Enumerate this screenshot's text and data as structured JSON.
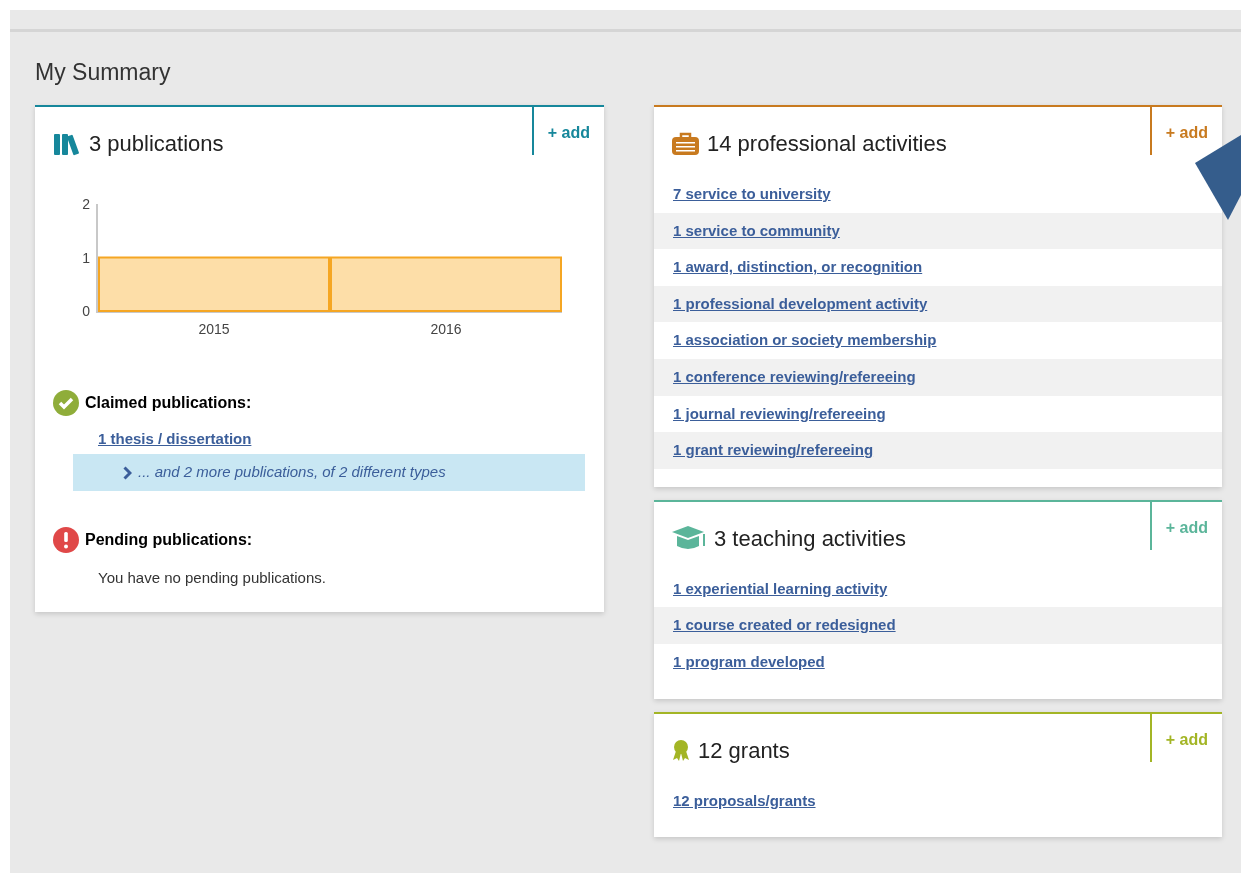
{
  "title": "My Summary",
  "publications": {
    "heading": "3 publications",
    "color": "#16879b",
    "add": "+ add",
    "chart_data": {
      "type": "bar",
      "categories": [
        "2015",
        "2016"
      ],
      "values": [
        1,
        1
      ],
      "ylim": [
        0,
        2
      ],
      "yticks": [
        0,
        1,
        2
      ]
    },
    "claimed": {
      "label": "Claimed publications:",
      "items": [
        "1 thesis / dissertation"
      ],
      "more": "... and 2 more publications, of 2 different types"
    },
    "pending": {
      "label": "Pending publications:",
      "message": "You have no pending publications."
    }
  },
  "panels": [
    {
      "kind": "briefcase",
      "heading": "14 professional activities",
      "color": "#c87a1f",
      "add": "+ add",
      "links": [
        "7 service to university",
        "1 service to community",
        "1 award, distinction, or recognition",
        "1 professional development activity",
        "1 association or society membership",
        "1 conference reviewing/refereeing",
        "1 journal reviewing/refereeing",
        "1 grant reviewing/refereeing"
      ]
    },
    {
      "kind": "graduation-cap",
      "heading": "3 teaching activities",
      "color": "#5bb59a",
      "add": "+ add",
      "links": [
        "1 experiential learning activity",
        "1 course created or redesigned",
        "1 program developed"
      ]
    },
    {
      "kind": "award",
      "heading": "12 grants",
      "color": "#a3b525",
      "add": "+ add",
      "links": [
        "12 proposals/grants"
      ]
    }
  ]
}
